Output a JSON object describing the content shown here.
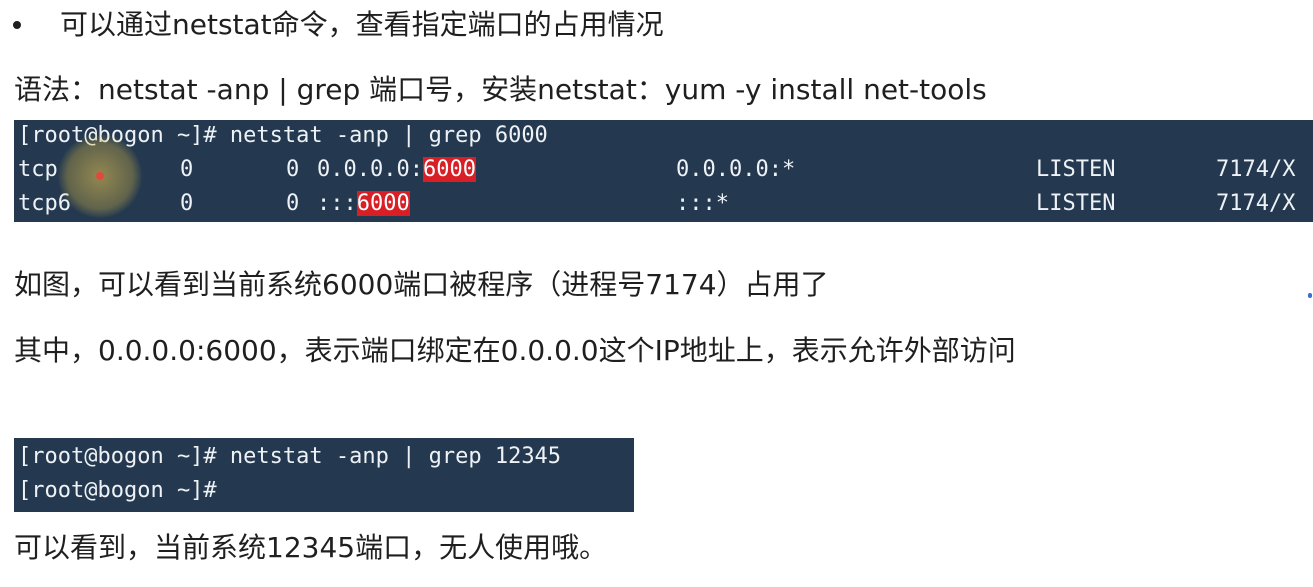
{
  "bullet": {
    "text": "可以通过netstat命令，查看指定端口的占用情况"
  },
  "syntax": {
    "text": "语法：netstat -anp | grep 端口号，安装netstat：yum -y install net-tools"
  },
  "terminal1": {
    "prompt": "[root@bogon ~]# netstat -anp | grep 6000",
    "rows": [
      {
        "proto": "tcp",
        "recv": "0",
        "send": "0",
        "local_prefix": "0.0.0.0:",
        "local_port": "6000",
        "foreign": "0.0.0.0:*",
        "state": "LISTEN",
        "pid": "7174/X"
      },
      {
        "proto": "tcp6",
        "recv": "0",
        "send": "0",
        "local_prefix": ":::",
        "local_port": "6000",
        "foreign": ":::*",
        "state": "LISTEN",
        "pid": "7174/X"
      }
    ]
  },
  "explain1": {
    "text": "如图，可以看到当前系统6000端口被程序（进程号7174）占用了"
  },
  "explain2": {
    "text": "其中，0.0.0.0:6000，表示端口绑定在0.0.0.0这个IP地址上，表示允许外部访问"
  },
  "terminal2": {
    "line1": "[root@bogon ~]# netstat -anp | grep 12345",
    "line2": "[root@bogon ~]#"
  },
  "explain3": {
    "text": "可以看到，当前系统12345端口，无人使用哦。"
  },
  "colors": {
    "terminal_bg": "#24394f",
    "highlight": "#d81f26",
    "text": "#1f1f1f"
  }
}
